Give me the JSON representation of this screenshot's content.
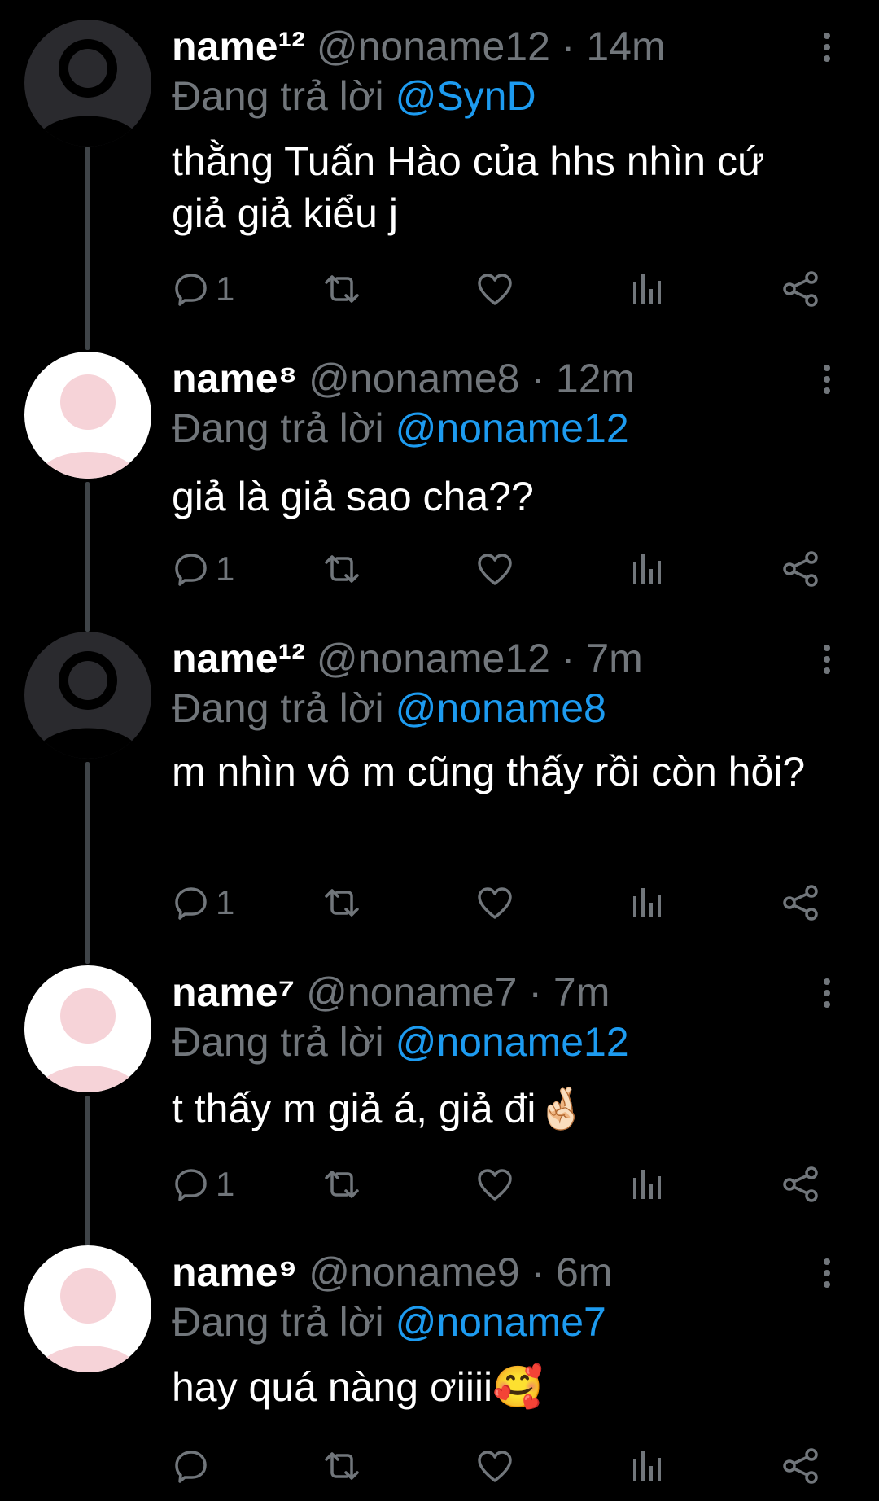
{
  "colors": {
    "background": "#000000",
    "text": "#ffffff",
    "secondary": "#71767b",
    "mention": "#1d9bf0",
    "thread_line": "#3f4448",
    "avatar_dark_bg": "#2a2a2e",
    "avatar_light_bg": "#ffffff",
    "avatar_pink": "#f6d3d8"
  },
  "labels": {
    "replying_to": "Đang trả lời",
    "separator": "·"
  },
  "tweets": [
    {
      "name": "name¹²",
      "handle": "@noname12",
      "time": "14m",
      "reply_to": "@SynD",
      "text": "thằng Tuấn Hào của hhs nhìn cứ giả giả kiểu j",
      "reply_count": "1",
      "avatar_style": "dark"
    },
    {
      "name": "name⁸",
      "handle": "@noname8",
      "time": "12m",
      "reply_to": "@noname12",
      "text": "giả là giả sao cha??",
      "reply_count": "1",
      "avatar_style": "light"
    },
    {
      "name": "name¹²",
      "handle": "@noname12",
      "time": "7m",
      "reply_to": "@noname8",
      "text": "m nhìn vô m cũng thấy rồi còn hỏi?",
      "reply_count": "1",
      "avatar_style": "dark"
    },
    {
      "name": "name⁷",
      "handle": "@noname7",
      "time": "7m",
      "reply_to": "@noname12",
      "text": "t thấy m giả á, giả đi🤞🏻",
      "reply_count": "1",
      "avatar_style": "light"
    },
    {
      "name": "name⁹",
      "handle": "@noname9",
      "time": "6m",
      "reply_to": "@noname7",
      "text": "hay quá nàng ơiiii🥰",
      "reply_count": "",
      "avatar_style": "light"
    }
  ],
  "icons": {
    "reply": "speech-bubble-icon",
    "retweet": "retweet-arrows-icon",
    "like": "heart-outline-icon",
    "views": "bar-chart-icon",
    "share": "share-nodes-icon",
    "more": "vertical-ellipsis-icon"
  }
}
